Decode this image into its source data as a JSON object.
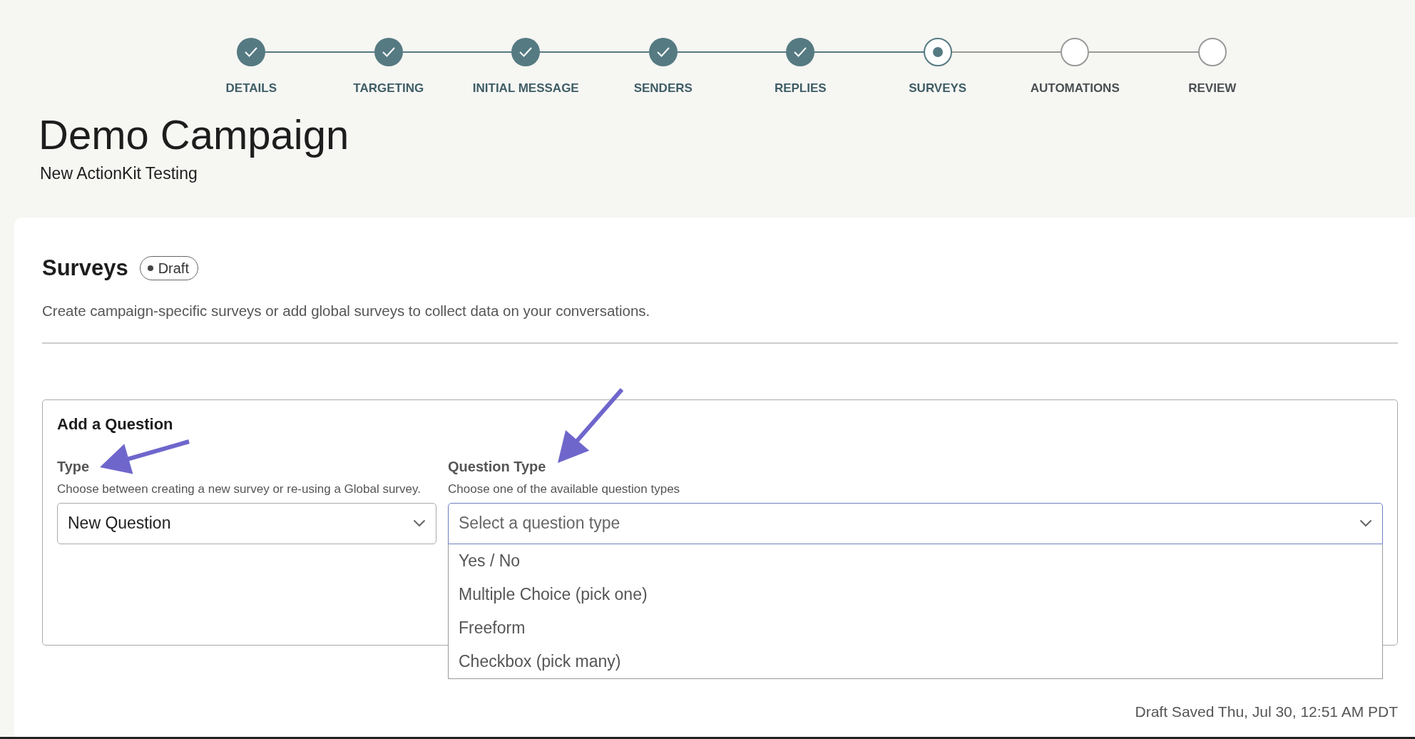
{
  "stepper": [
    {
      "label": "DETAILS",
      "completed": true,
      "selected": false
    },
    {
      "label": "TARGETING",
      "completed": true,
      "selected": false
    },
    {
      "label": "INITIAL MESSAGE",
      "completed": true,
      "selected": false
    },
    {
      "label": "SENDERS",
      "completed": true,
      "selected": false
    },
    {
      "label": "REPLIES",
      "completed": true,
      "selected": false
    },
    {
      "label": "SURVEYS",
      "completed": false,
      "selected": true
    },
    {
      "label": "AUTOMATIONS",
      "completed": false,
      "selected": false
    },
    {
      "label": "REVIEW",
      "completed": false,
      "selected": false
    }
  ],
  "campaign": {
    "title": "Demo Campaign",
    "subtitle": "New ActionKit Testing"
  },
  "section": {
    "title": "Surveys",
    "status_badge": "Draft",
    "description": "Create campaign-specific surveys or add global surveys to collect data on your conversations."
  },
  "add_question": {
    "title": "Add a Question",
    "fields": [
      {
        "label": "Type",
        "help": "Choose between creating a new survey or re-using a Global survey.",
        "value": "New Question",
        "expanded": false
      },
      {
        "label": "Question Type",
        "help": "Choose one of the available question types",
        "placeholder": "Select a question type",
        "expanded": true,
        "options": [
          "Yes / No",
          "Multiple Choice (pick one)",
          "Freeform",
          "Checkbox (pick many)"
        ]
      }
    ]
  },
  "status_bar": {
    "saved": "Draft Saved Thu, Jul 30, 12:51 AM PDT"
  }
}
